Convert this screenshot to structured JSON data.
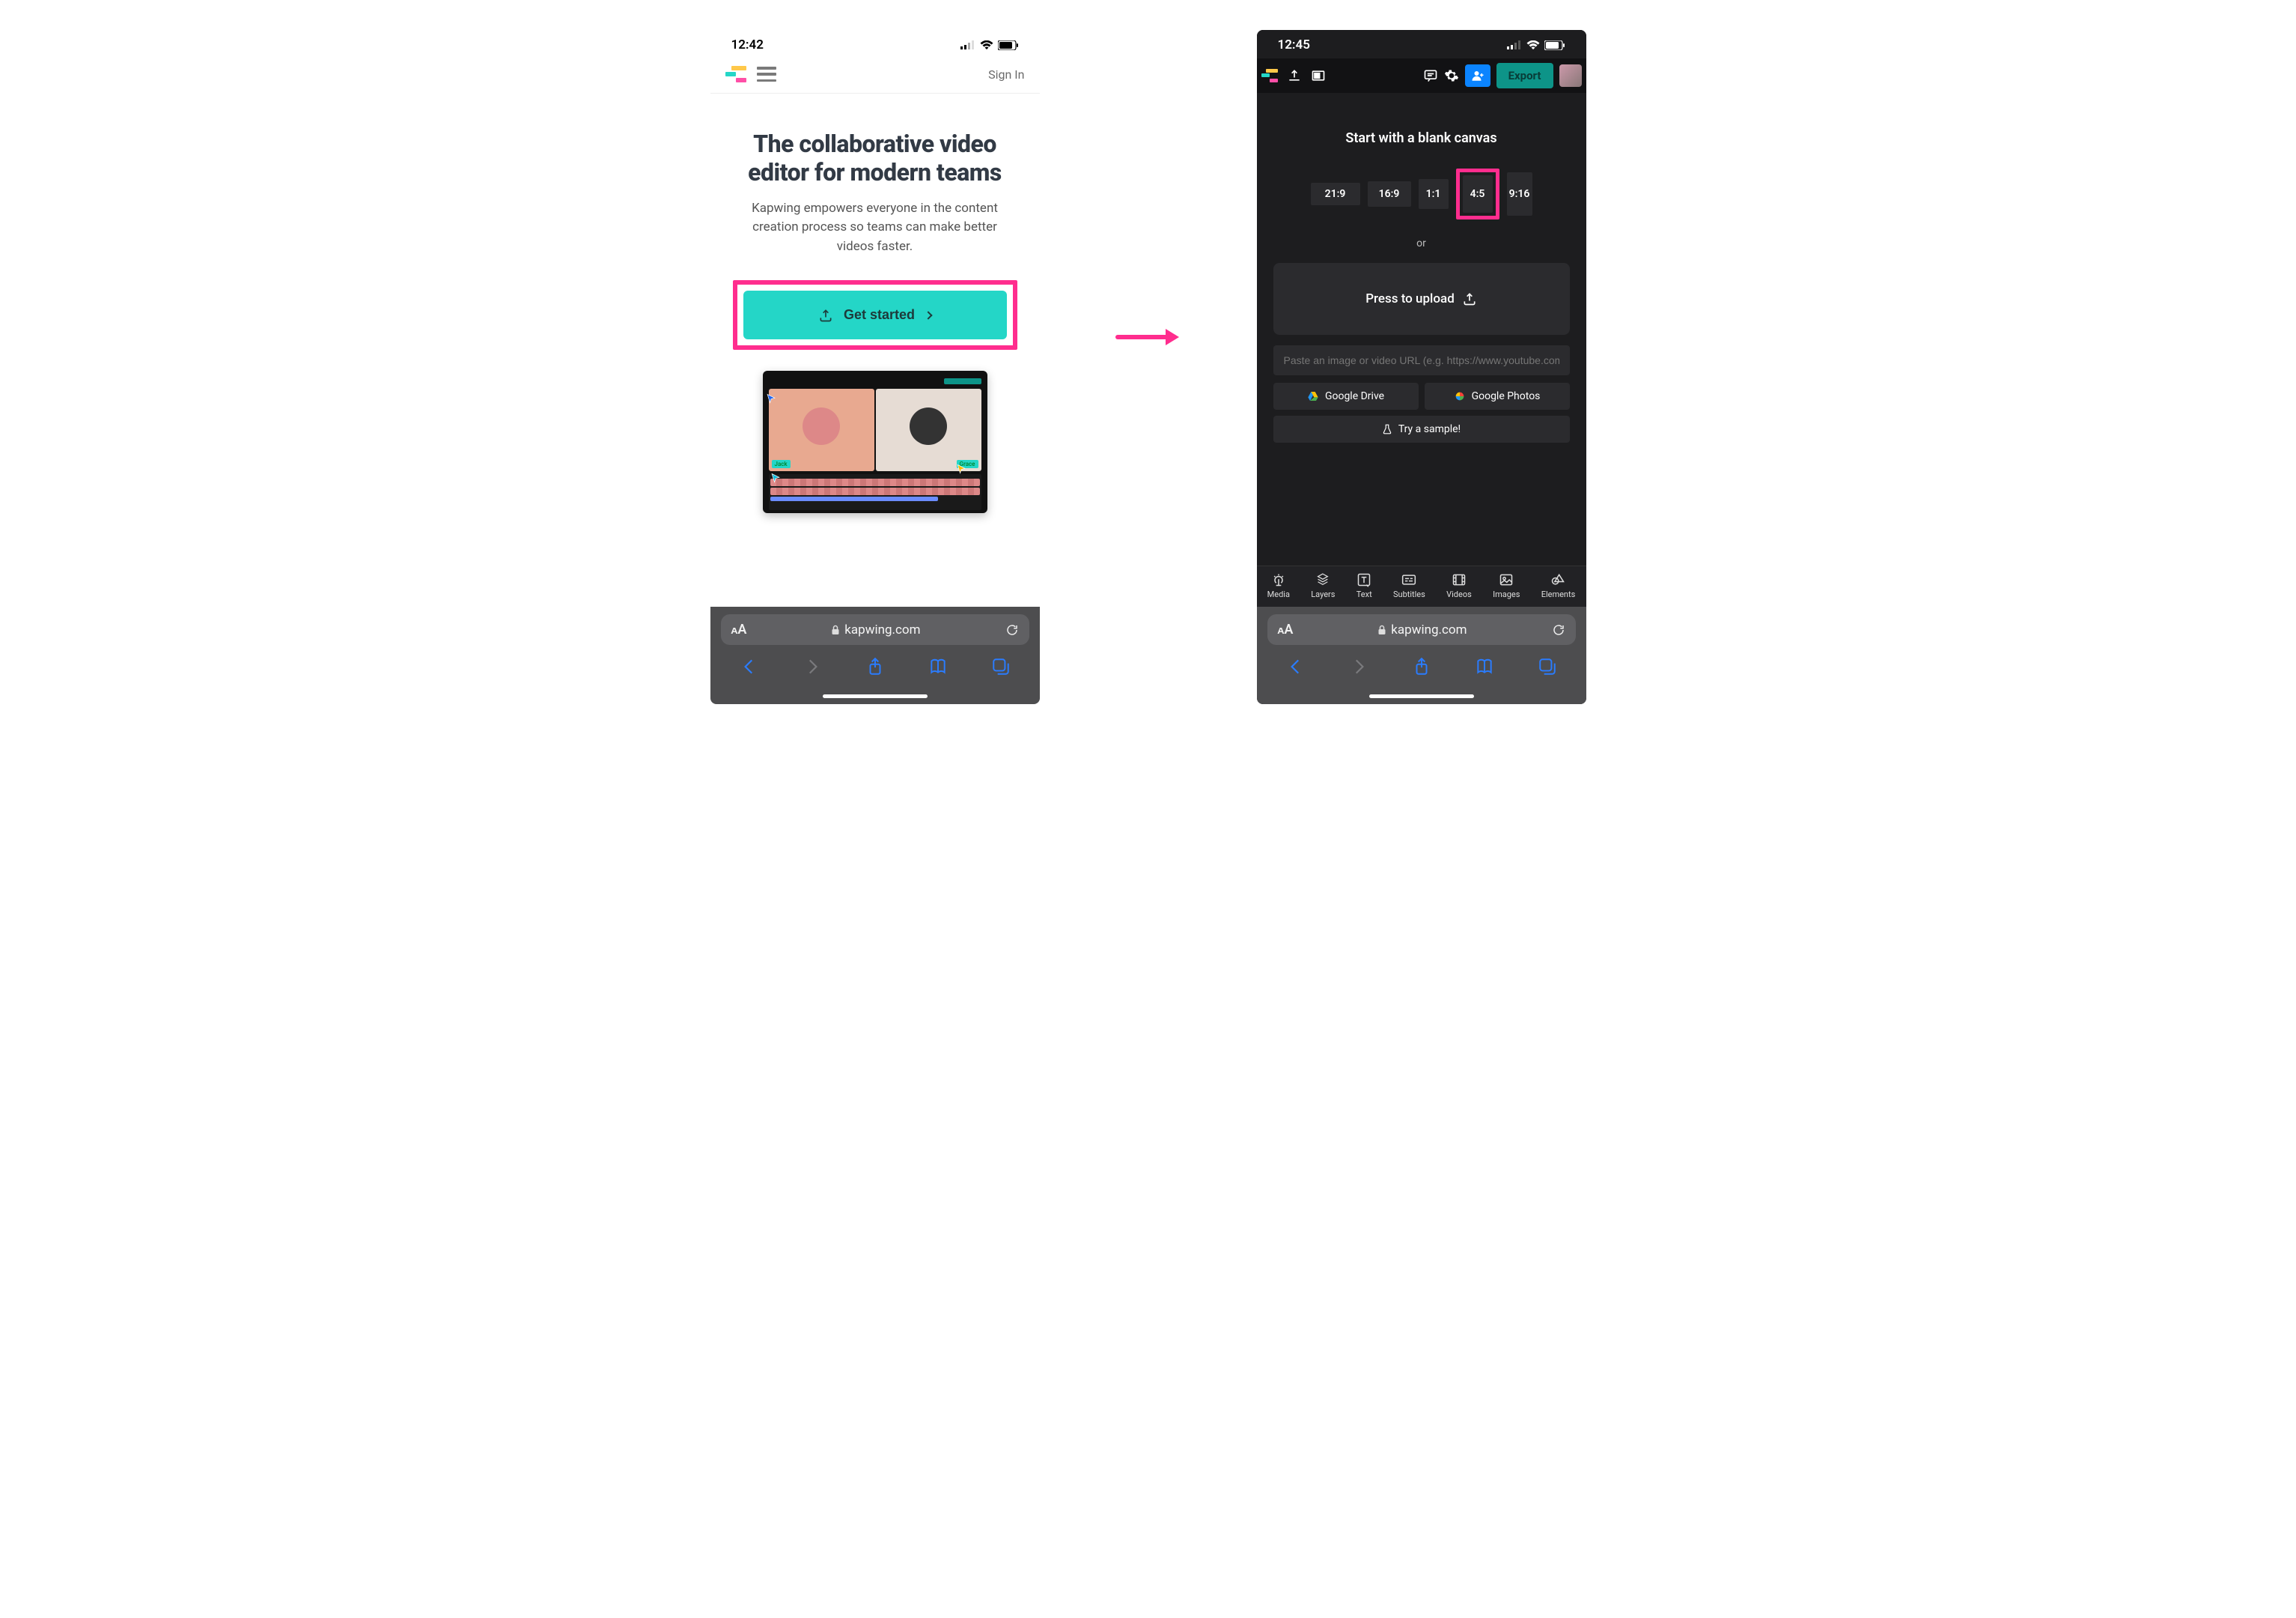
{
  "status": {
    "time_left": "12:42",
    "time_right": "12:45"
  },
  "landing": {
    "signin": "Sign In",
    "title": "The collaborative video editor for modern teams",
    "subtitle": "Kapwing empowers everyone in the content creation process so teams can make better videos faster.",
    "cta": "Get started",
    "preview_names": {
      "left": "Jack",
      "right": "Grace"
    }
  },
  "editor": {
    "export": "Export",
    "title": "Start with a blank canvas",
    "ratios": {
      "r219": "21:9",
      "r169": "16:9",
      "r11": "1:1",
      "r45": "4:5",
      "r916": "9:16"
    },
    "or": "or",
    "upload": "Press to upload",
    "url_placeholder": "Paste an image or video URL (e.g. https://www.youtube.com/…",
    "gdrive": "Google Drive",
    "gphotos": "Google Photos",
    "sample": "Try a sample!",
    "tabs": {
      "media": "Media",
      "layers": "Layers",
      "text": "Text",
      "subtitles": "Subtitles",
      "videos": "Videos",
      "images": "Images",
      "elements": "Elements"
    }
  },
  "safari": {
    "domain": "kapwing.com",
    "aa": "AA"
  }
}
